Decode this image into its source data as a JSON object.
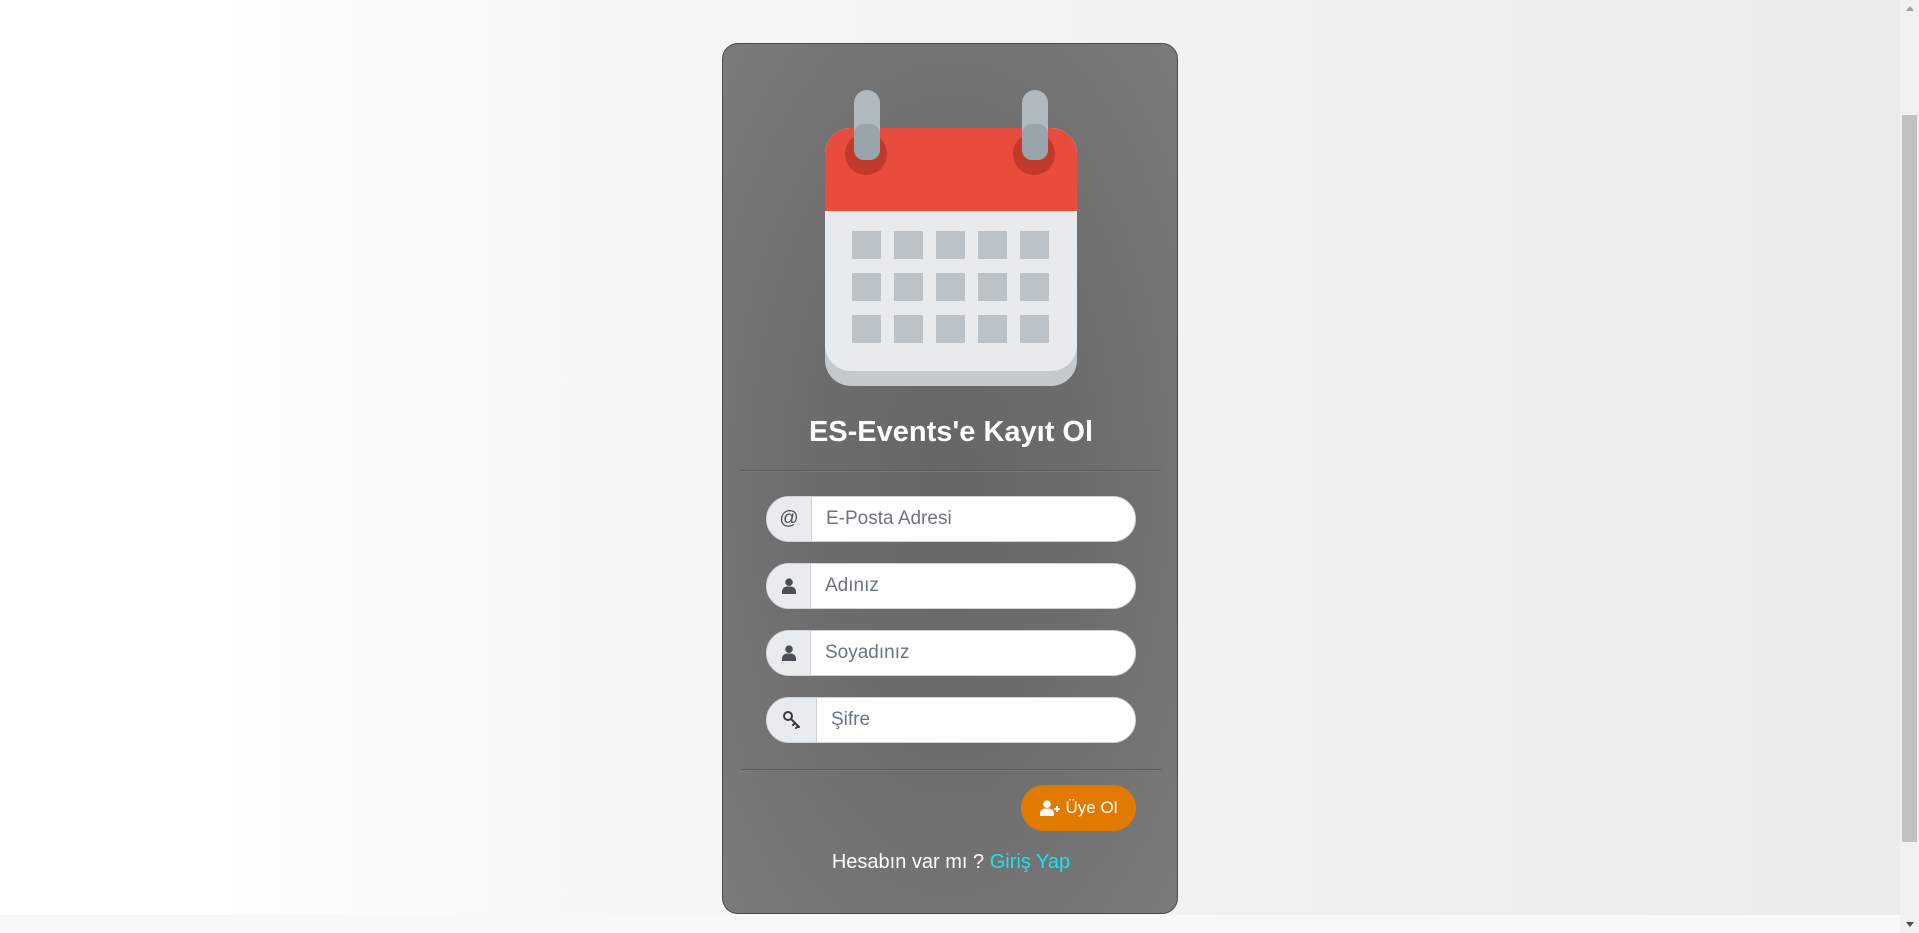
{
  "register": {
    "title": "ES-Events'e Kayıt Ol",
    "email_symbol": "@",
    "email_placeholder": "E-Posta Adresi",
    "first_name_placeholder": "Adınız",
    "last_name_placeholder": "Soyadınız",
    "password_placeholder": "Şifre",
    "submit_label": "Üye Ol",
    "login_prompt": "Hesabın var mı ?",
    "login_link": "Giriş Yap"
  },
  "icons": {
    "logo": "calendar-icon",
    "email": "at-icon",
    "first_name": "user-icon",
    "last_name": "user-icon",
    "password": "key-icon",
    "submit": "user-plus-icon"
  },
  "colors": {
    "card_bg": "#6d6d6d",
    "calendar_header": "#e74c3c",
    "submit_bg": "#e07b00",
    "link": "#19e3ef"
  }
}
